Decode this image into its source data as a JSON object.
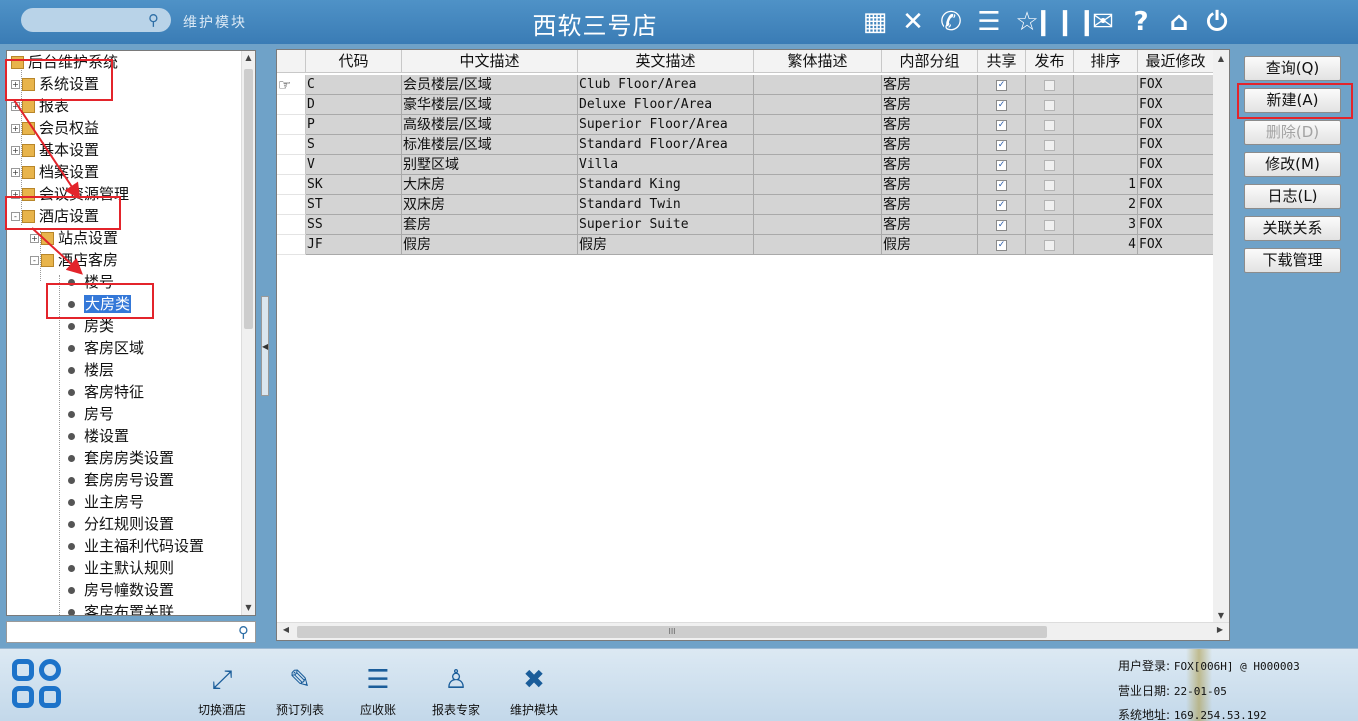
{
  "topbar": {
    "module_label": "维护模块",
    "title": "西软三号店",
    "icons": [
      "signal-icon",
      "tools-icon",
      "phone-icon",
      "menu-icon",
      "star-icon",
      "columns-icon",
      "mail-icon",
      "help-icon",
      "home-icon",
      "power-icon"
    ]
  },
  "tree": {
    "root": "后台维护系统",
    "nodes": [
      {
        "label": "系统设置",
        "expander": "+"
      },
      {
        "label": "报表",
        "expander": "+"
      },
      {
        "label": "会员权益",
        "expander": "+"
      },
      {
        "label": "基本设置",
        "expander": "+"
      },
      {
        "label": "档案设置",
        "expander": "+"
      },
      {
        "label": "会议资源管理",
        "expander": "+"
      },
      {
        "label": "酒店设置",
        "expander": "-"
      },
      {
        "label": "站点设置",
        "expander": "+"
      },
      {
        "label": "酒店客房",
        "expander": "-"
      },
      {
        "label": "楼号"
      },
      {
        "label": "大房类",
        "selected": true
      },
      {
        "label": "房类"
      },
      {
        "label": "客房区域"
      },
      {
        "label": "楼层"
      },
      {
        "label": "客房特征"
      },
      {
        "label": "房号"
      },
      {
        "label": "楼设置"
      },
      {
        "label": "套房房类设置"
      },
      {
        "label": "套房房号设置"
      },
      {
        "label": "业主房号"
      },
      {
        "label": "分红规则设置"
      },
      {
        "label": "业主福利代码设置"
      },
      {
        "label": "业主默认规则"
      },
      {
        "label": "房号幢数设置"
      },
      {
        "label": "客房布置关联"
      }
    ],
    "search_value": ""
  },
  "grid": {
    "columns": [
      "代码",
      "中文描述",
      "英文描述",
      "繁体描述",
      "内部分组",
      "共享",
      "发布",
      "排序",
      "最近修改"
    ],
    "rows": [
      {
        "code": "C",
        "cn": "会员楼层/区域",
        "en": "Club Floor/Area",
        "tw": "",
        "group": "客房",
        "share": true,
        "publish": false,
        "sort": "",
        "modby": "FOX"
      },
      {
        "code": "D",
        "cn": "豪华楼层/区域",
        "en": "Deluxe Floor/Area",
        "tw": "",
        "group": "客房",
        "share": true,
        "publish": false,
        "sort": "",
        "modby": "FOX"
      },
      {
        "code": "P",
        "cn": "高级楼层/区域",
        "en": "Superior Floor/Area",
        "tw": "",
        "group": "客房",
        "share": true,
        "publish": false,
        "sort": "",
        "modby": "FOX"
      },
      {
        "code": "S",
        "cn": "标准楼层/区域",
        "en": "Standard Floor/Area",
        "tw": "",
        "group": "客房",
        "share": true,
        "publish": false,
        "sort": "",
        "modby": "FOX"
      },
      {
        "code": "V",
        "cn": "别墅区域",
        "en": "Villa",
        "tw": "",
        "group": "客房",
        "share": true,
        "publish": false,
        "sort": "",
        "modby": "FOX"
      },
      {
        "code": "SK",
        "cn": "大床房",
        "en": "Standard King",
        "tw": "",
        "group": "客房",
        "share": true,
        "publish": false,
        "sort": "1",
        "modby": "FOX"
      },
      {
        "code": "ST",
        "cn": "双床房",
        "en": "Standard Twin",
        "tw": "",
        "group": "客房",
        "share": true,
        "publish": false,
        "sort": "2",
        "modby": "FOX"
      },
      {
        "code": "SS",
        "cn": "套房",
        "en": "Superior Suite",
        "tw": "",
        "group": "客房",
        "share": true,
        "publish": false,
        "sort": "3",
        "modby": "FOX"
      },
      {
        "code": "JF",
        "cn": "假房",
        "en": "假房",
        "tw": "",
        "group": "假房",
        "share": true,
        "publish": false,
        "sort": "4",
        "modby": "FOX"
      }
    ],
    "hscroll_grip": "III"
  },
  "buttons": [
    {
      "label": "查询(Q)",
      "enabled": true
    },
    {
      "label": "新建(A)",
      "enabled": true
    },
    {
      "label": "删除(D)",
      "enabled": false
    },
    {
      "label": "修改(M)",
      "enabled": true
    },
    {
      "label": "日志(L)",
      "enabled": true
    },
    {
      "label": "关联关系",
      "enabled": true
    },
    {
      "label": "下载管理",
      "enabled": true
    }
  ],
  "bottombar": {
    "items": [
      {
        "label": "切换酒店",
        "icon": "switch-hotel-icon"
      },
      {
        "label": "预订列表",
        "icon": "booking-list-icon"
      },
      {
        "label": "应收账",
        "icon": "receivable-icon"
      },
      {
        "label": "报表专家",
        "icon": "report-expert-icon"
      },
      {
        "label": "维护模块",
        "icon": "maintenance-icon"
      }
    ],
    "status": {
      "user_label": "用户登录:",
      "user_value": "FOX[006H] @ H000003",
      "date_label": "营业日期:",
      "date_value": "22-01-05",
      "addr_label": "系统地址:",
      "addr_value": "169.254.53.192"
    }
  },
  "colors": {
    "topbar": "#3f82bb",
    "selection": "#3478d8",
    "highlight": "#e3242b",
    "row_fill": "#d4d4d4"
  }
}
